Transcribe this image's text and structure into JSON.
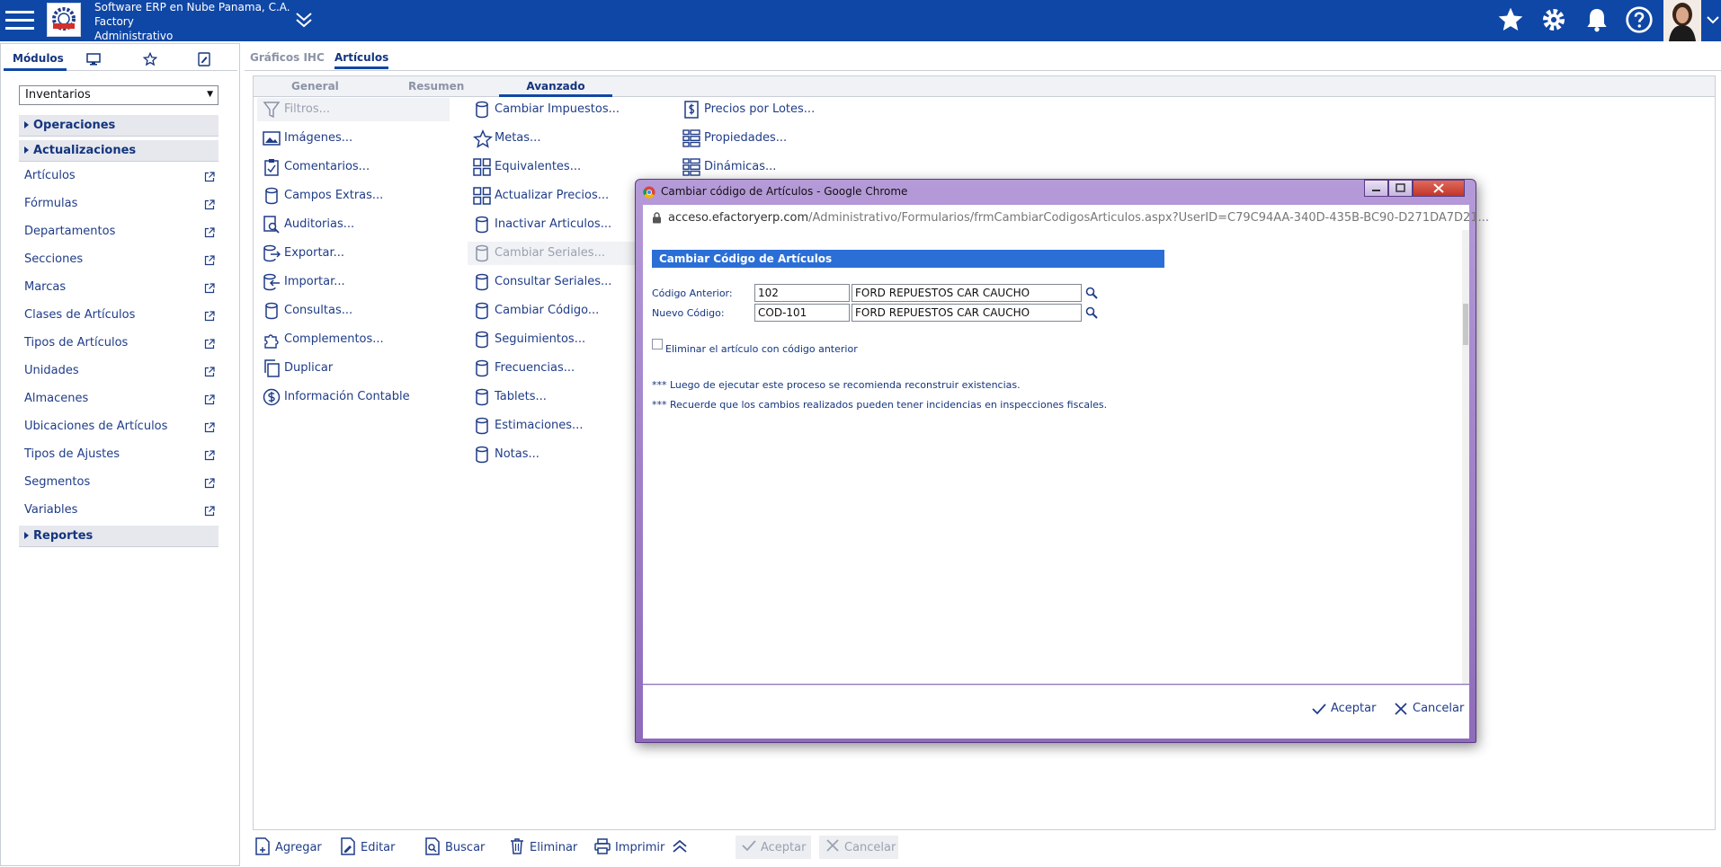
{
  "header": {
    "company": "Software ERP en Nube Panama, C.A.",
    "app": "Factory",
    "module": "Administrativo"
  },
  "left": {
    "tabs": [
      "Módulos"
    ],
    "module_select": "Inventarios",
    "sections": {
      "operaciones": "Operaciones",
      "actualizaciones": "Actualizaciones",
      "reportes": "Reportes"
    },
    "items": [
      "Artículos",
      "Fórmulas",
      "Departamentos",
      "Secciones",
      "Marcas",
      "Clases de Artículos",
      "Tipos de Artículos",
      "Unidades",
      "Almacenes",
      "Ubicaciones de Artículos",
      "Tipos de Ajustes",
      "Segmentos",
      "Variables"
    ]
  },
  "main": {
    "tabs": [
      "Gráficos IHC",
      "Artículos"
    ],
    "subtabs": [
      "General",
      "Resumen",
      "Avanzado"
    ],
    "col1": [
      "Filtros...",
      "Imágenes...",
      "Comentarios...",
      "Campos Extras...",
      "Auditorias...",
      "Exportar...",
      "Importar...",
      "Consultas...",
      "Complementos...",
      "Duplicar",
      "Información Contable"
    ],
    "col2": [
      "Cambiar Impuestos...",
      "Metas...",
      "Equivalentes...",
      "Actualizar Precios...",
      "Inactivar Articulos...",
      "Cambiar Seriales...",
      "Consultar Seriales...",
      "Cambiar Código...",
      "Seguimientos...",
      "Frecuencias...",
      "Tablets...",
      "Estimaciones...",
      "Notas..."
    ],
    "col3": [
      "Precios por Lotes...",
      "Propiedades...",
      "Dinámicas..."
    ]
  },
  "toolbar": {
    "add": "Agregar",
    "edit": "Editar",
    "search": "Buscar",
    "delete": "Eliminar",
    "print": "Imprimir",
    "accept": "Aceptar",
    "cancel": "Cancelar"
  },
  "dialog": {
    "window_title": "Cambiar código de Artículos - Google Chrome",
    "url_host": "acceso.efactoryerp.com",
    "url_path": "/Administrativo/Formularios/frmCambiarCodigosArticulos.aspx?UserID=C79C94AA-340D-435B-BC90-D271DA7D21...",
    "heading": "Cambiar Código de Artículos",
    "old_code_label": "Código Anterior:",
    "old_code": "102",
    "old_desc": "FORD REPUESTOS CAR CAUCHO",
    "new_code_label": "Nuevo Código:",
    "new_code": "COD-101",
    "new_desc": "FORD REPUESTOS CAR CAUCHO",
    "checkbox_label": "Eliminar el artículo con código anterior",
    "note1": "*** Luego de ejecutar este proceso se recomienda reconstruir existencias.",
    "note2": "*** Recuerde que los cambios realizados pueden tener incidencias en inspecciones fiscales.",
    "accept": "Aceptar",
    "cancel": "Cancelar"
  }
}
